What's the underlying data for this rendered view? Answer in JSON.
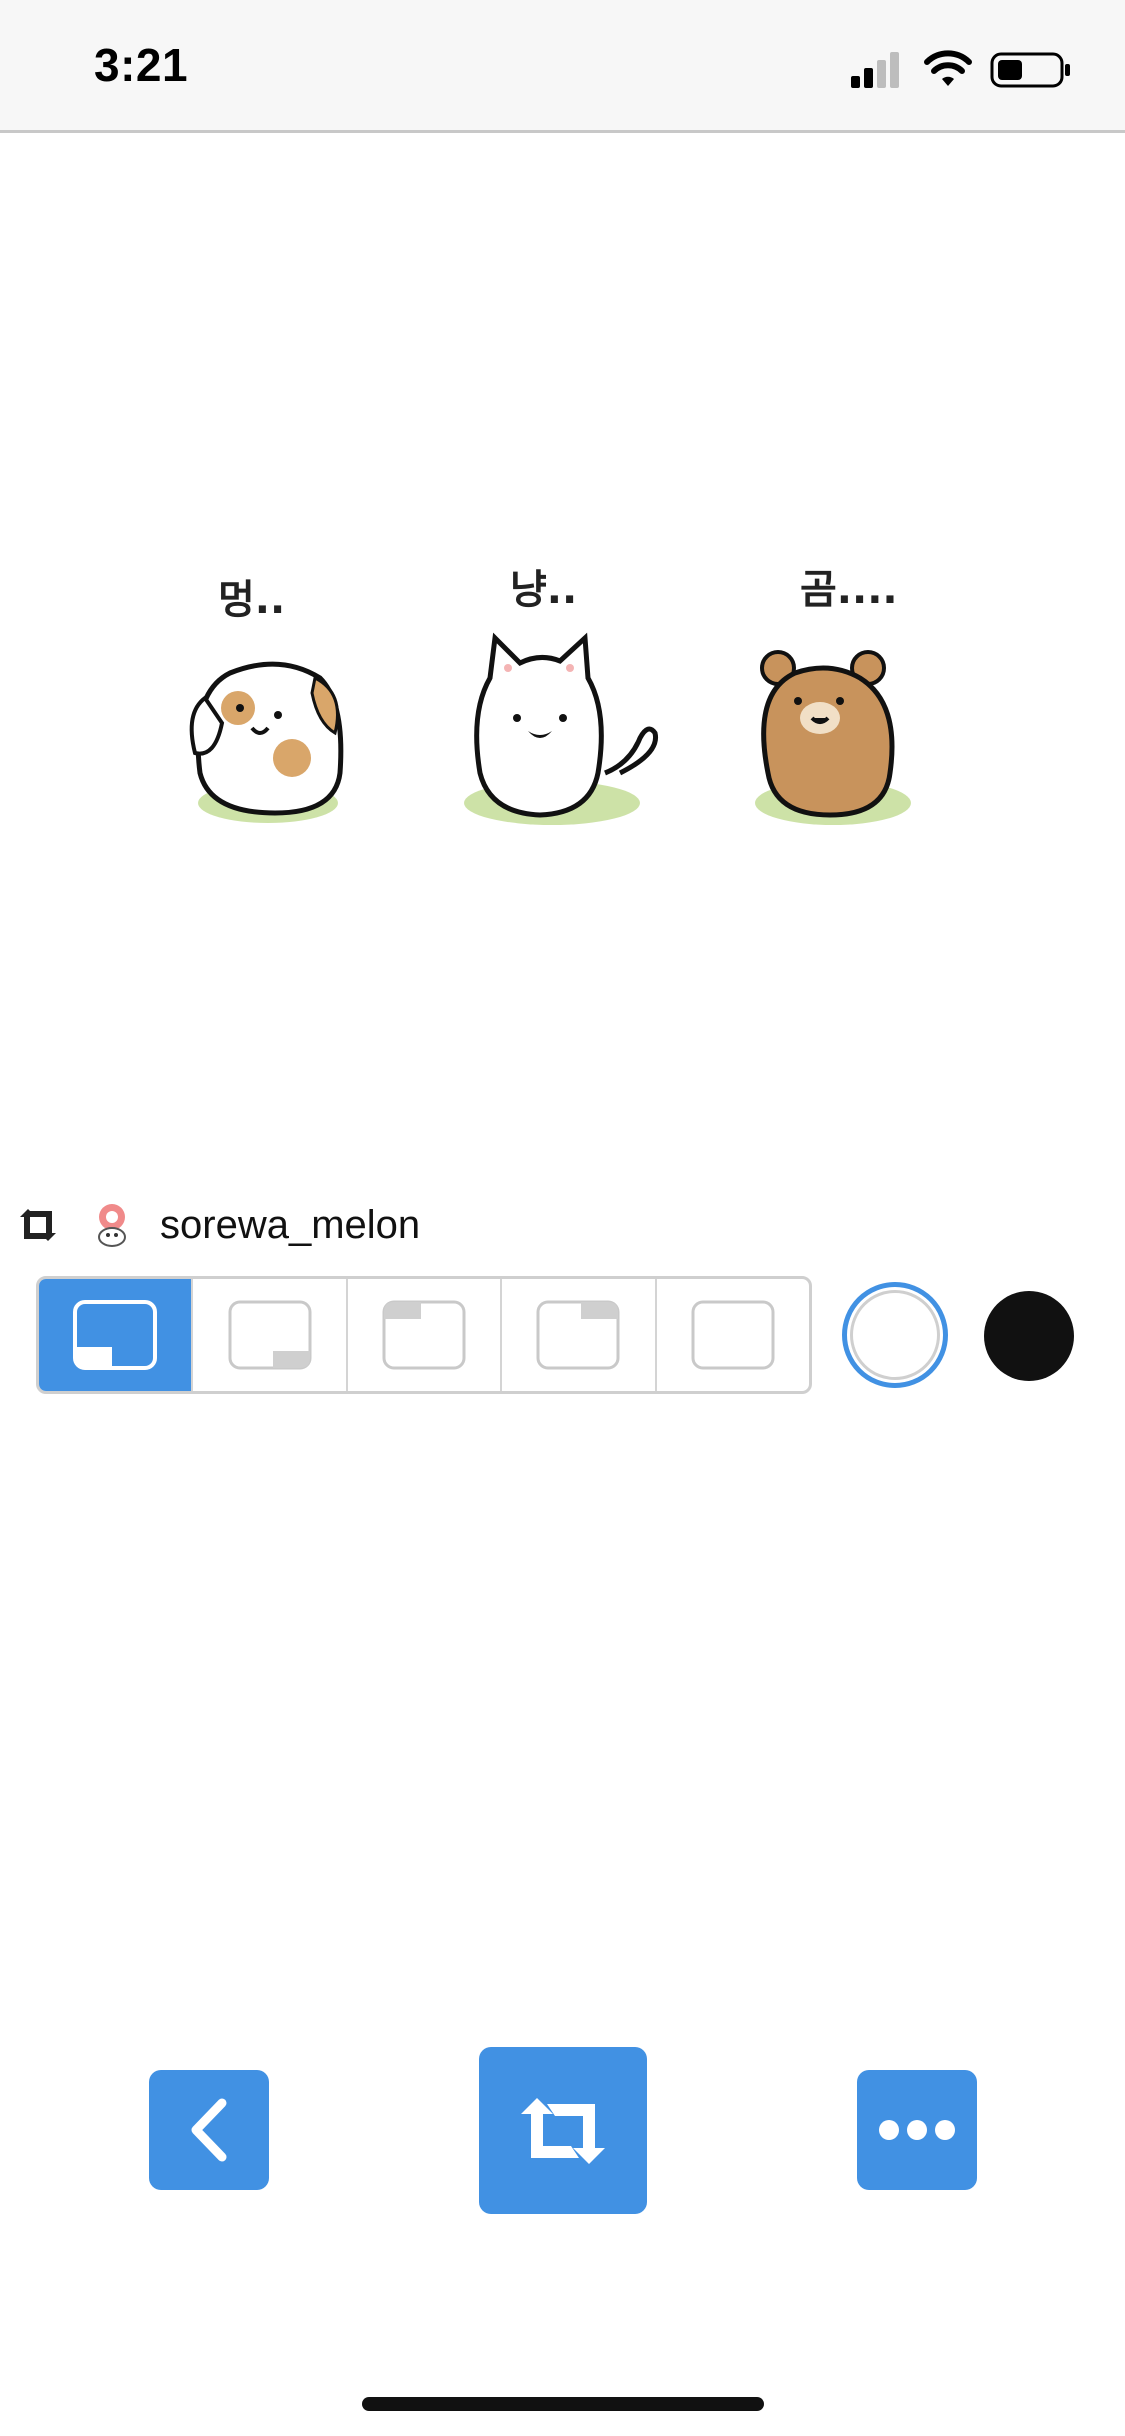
{
  "status_bar": {
    "time": "3:21",
    "icons": [
      "cellular-signal-icon",
      "wifi-icon",
      "battery-icon"
    ]
  },
  "sticker": {
    "characters": [
      {
        "name": "puppy",
        "caption": "멍.."
      },
      {
        "name": "cat",
        "caption": "냥.."
      },
      {
        "name": "bear",
        "caption": "곰...."
      }
    ]
  },
  "attribution": {
    "icon": "retweet-icon",
    "avatar": "avatar",
    "username": "sorewa_melon"
  },
  "position_options": {
    "selected_index": 0,
    "options": [
      "bottom-left",
      "bottom-right",
      "top-left",
      "top-right",
      "none"
    ]
  },
  "color_options": {
    "selected": "white",
    "colors": [
      {
        "name": "white",
        "hex": "#ffffff"
      },
      {
        "name": "black",
        "hex": "#111111"
      }
    ]
  },
  "actions": {
    "back": "chevron-left-icon",
    "retweet": "retweet-icon",
    "more": "more-icon"
  },
  "colors": {
    "accent": "#4191e3",
    "status_bar_bg": "#f7f7f7"
  }
}
